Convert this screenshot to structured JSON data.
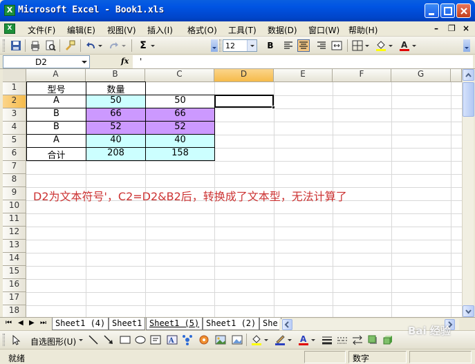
{
  "window": {
    "title": "Microsoft Excel - Book1.xls",
    "app_icon": "excel-icon"
  },
  "menu": {
    "items": [
      "文件(F)",
      "编辑(E)",
      "视图(V)",
      "插入(I)",
      "格式(O)",
      "工具(T)",
      "数据(D)",
      "窗口(W)",
      "帮助(H)"
    ]
  },
  "toolbar": {
    "font_size": "12",
    "bold_label": "B",
    "sigma_label": "Σ"
  },
  "formula_bar": {
    "name_box": "D2",
    "fx_label": "fx",
    "content": "'"
  },
  "grid": {
    "columns": [
      "A",
      "B",
      "C",
      "D",
      "E",
      "F",
      "G"
    ],
    "rows": [
      "1",
      "2",
      "3",
      "4",
      "5",
      "6",
      "7",
      "8",
      "9",
      "10",
      "11",
      "12",
      "13",
      "14",
      "15",
      "16",
      "17",
      "18"
    ],
    "selected_cell": "D2",
    "cells": {
      "A1": "型号",
      "B1": "数量",
      "A2": "A",
      "B2": "50",
      "C2": "50",
      "A3": "B",
      "B3": "66",
      "C3": "66",
      "A4": "B",
      "B4": "52",
      "C4": "52",
      "A5": "A",
      "B5": "40",
      "C5": "40",
      "A6": "合计",
      "B6": "208",
      "C6": "158"
    },
    "note": "D2为文本符号'，C2=D2&B2后，转换成了文本型，无法计算了",
    "colors": {
      "cyan": "#ccffff",
      "violet": "#cc99ff",
      "note": "#cc3333"
    }
  },
  "sheet_tabs": [
    "Sheet1 (4)",
    "Sheet1",
    "Sheet1 (5)",
    "Sheet1 (2)",
    "She"
  ],
  "active_sheet": "Sheet1 (5)",
  "draw_toolbar": {
    "autoshapes_label": "自选图形(U)"
  },
  "status": {
    "left": "就绪",
    "mode": "数字"
  },
  "watermark": "Bai 经验"
}
